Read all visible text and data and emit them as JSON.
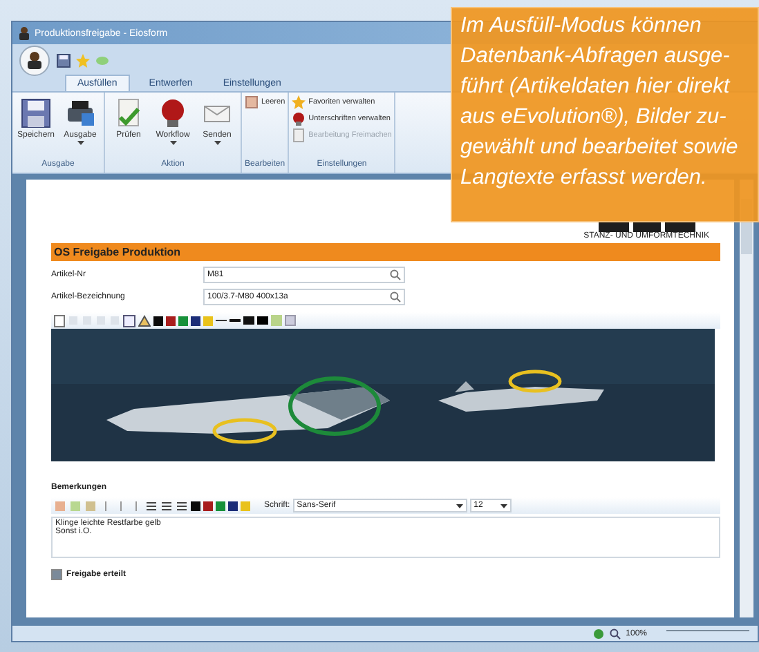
{
  "window": {
    "title": "Produktionsfreigabe - Eiosform"
  },
  "tabs": [
    {
      "label": "Ausfüllen",
      "selected": true
    },
    {
      "label": "Entwerfen",
      "selected": false
    },
    {
      "label": "Einstellungen",
      "selected": false
    }
  ],
  "ribbon": [
    {
      "label": "Ausgabe",
      "buttons": [
        {
          "kind": "large",
          "label": "Speichern",
          "dropdown": false
        },
        {
          "kind": "large",
          "label": "Ausgabe",
          "dropdown": true
        }
      ]
    },
    {
      "label": "Aktion",
      "buttons": [
        {
          "kind": "large",
          "label": "Prüfen",
          "dropdown": false
        },
        {
          "kind": "large",
          "label": "Workflow",
          "dropdown": true
        },
        {
          "kind": "large",
          "label": "Senden",
          "dropdown": true
        }
      ]
    },
    {
      "label": "Bearbeiten",
      "buttons": [
        {
          "kind": "small",
          "label": "Leeren",
          "disabled": false
        }
      ]
    },
    {
      "label": "Einstellungen",
      "buttons": [
        {
          "kind": "small",
          "label": "Favoriten verwalten",
          "disabled": false
        },
        {
          "kind": "small",
          "label": "Unterschriften verwalten",
          "disabled": false
        },
        {
          "kind": "small",
          "label": "Bearbeitung Freimachen",
          "disabled": true
        }
      ]
    }
  ],
  "form": {
    "logo_text": "STANZ- UND UMFORMTECHNIK",
    "heading": "OS Freigabe Produktion",
    "fields": [
      {
        "label": "Artikel-Nr",
        "value": "M81"
      },
      {
        "label": "Artikel-Bezeichnung",
        "value": "100/3.7-M80 400x13a"
      }
    ],
    "image_toolbar": {
      "swatches": [
        {
          "color": "#0a0a0a"
        },
        {
          "color": "#a81d1d"
        },
        {
          "color": "#17913a"
        },
        {
          "color": "#1b2d78"
        },
        {
          "color": "#e9c21b"
        }
      ]
    },
    "remarks_label": "Bemerkungen",
    "text_toolbar": {
      "swatches": [
        {
          "color": "#0a0a0a"
        },
        {
          "color": "#a81d1d"
        },
        {
          "color": "#17913a"
        },
        {
          "color": "#1b2d78"
        },
        {
          "color": "#e9c21b"
        }
      ],
      "font_label": "Schrift:",
      "font": "Sans-Serif",
      "size": "12"
    },
    "remarks": [
      "Klinge leichte Restfarbe gelb",
      "Sonst i.O."
    ],
    "approval": {
      "label": "Freigabe erteilt",
      "checked": true
    }
  },
  "status_bar": {
    "zoom": "100%"
  },
  "callout": {
    "lines": [
      "Im Ausfüll-Modus können",
      "Datenbank-Abfragen ausge-",
      "führt (Artikeldaten hier direkt",
      "aus eEvolution®), Bilder zu-",
      "gewählt und bearbeitet sowie",
      "Langtexte erfasst werden."
    ]
  }
}
